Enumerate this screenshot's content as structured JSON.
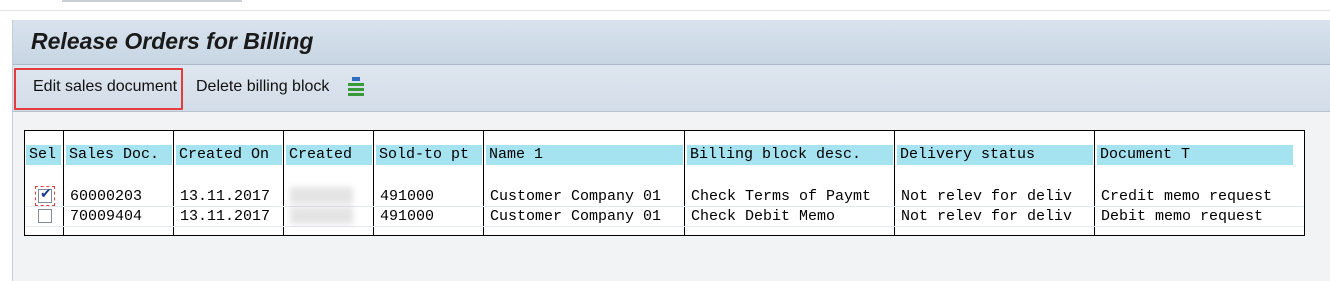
{
  "window": {
    "title": "Release Orders for Billing"
  },
  "toolbar": {
    "edit_label": "Edit sales document",
    "delete_label": "Delete billing block",
    "layout_icon": "select-layout-icon"
  },
  "colors": {
    "header_bg": "#a6e3f0",
    "highlight": "#e23c3c",
    "check_color": "#1b3d8f"
  },
  "table": {
    "columns": [
      "Sel",
      "Sales Doc.",
      "Created On",
      "Created",
      "Sold-to pt",
      "Name 1",
      "Billing block desc.",
      "Delivery status",
      "Document T"
    ],
    "rows": [
      {
        "selected": true,
        "sales_doc": "60000203",
        "created_on": "13.11.2017",
        "created": "",
        "sold_to": "491000",
        "name1": "Customer Company 01",
        "billing_block": "Check Terms of Paymt",
        "delivery_status": "Not relev for deliv",
        "doc_type": "Credit memo request"
      },
      {
        "selected": false,
        "sales_doc": "70009404",
        "created_on": "13.11.2017",
        "created": "",
        "sold_to": "491000",
        "name1": "Customer Company 01",
        "billing_block": "Check Debit Memo",
        "delivery_status": "Not relev for deliv",
        "doc_type": "Debit memo request"
      }
    ]
  }
}
